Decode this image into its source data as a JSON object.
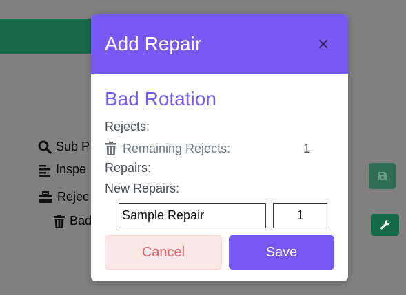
{
  "background": {
    "items": [
      {
        "icon": "search-icon",
        "label": "Sub P"
      },
      {
        "icon": "align-left-icon",
        "label": "Inspe"
      },
      {
        "icon": "toolbox-icon",
        "label": "Rejec"
      },
      {
        "icon": "trash-icon",
        "label": "Bad"
      }
    ]
  },
  "modal": {
    "title": "Add Repair",
    "repair_name": "Bad Rotation",
    "rejects_label": "Rejects:",
    "reject_item": {
      "label": "Remaining Rejects:",
      "count": "1"
    },
    "repairs_label": "Repairs:",
    "new_repairs_label": "New Repairs:",
    "new_repair": {
      "name_value": "Sample Repair",
      "quantity_value": "1"
    },
    "cancel_label": "Cancel",
    "save_label": "Save"
  },
  "colors": {
    "accent": "#7659f3",
    "cancel_text": "#e0606a",
    "cancel_bg": "#fde8e8",
    "backdrop": "#808080"
  }
}
